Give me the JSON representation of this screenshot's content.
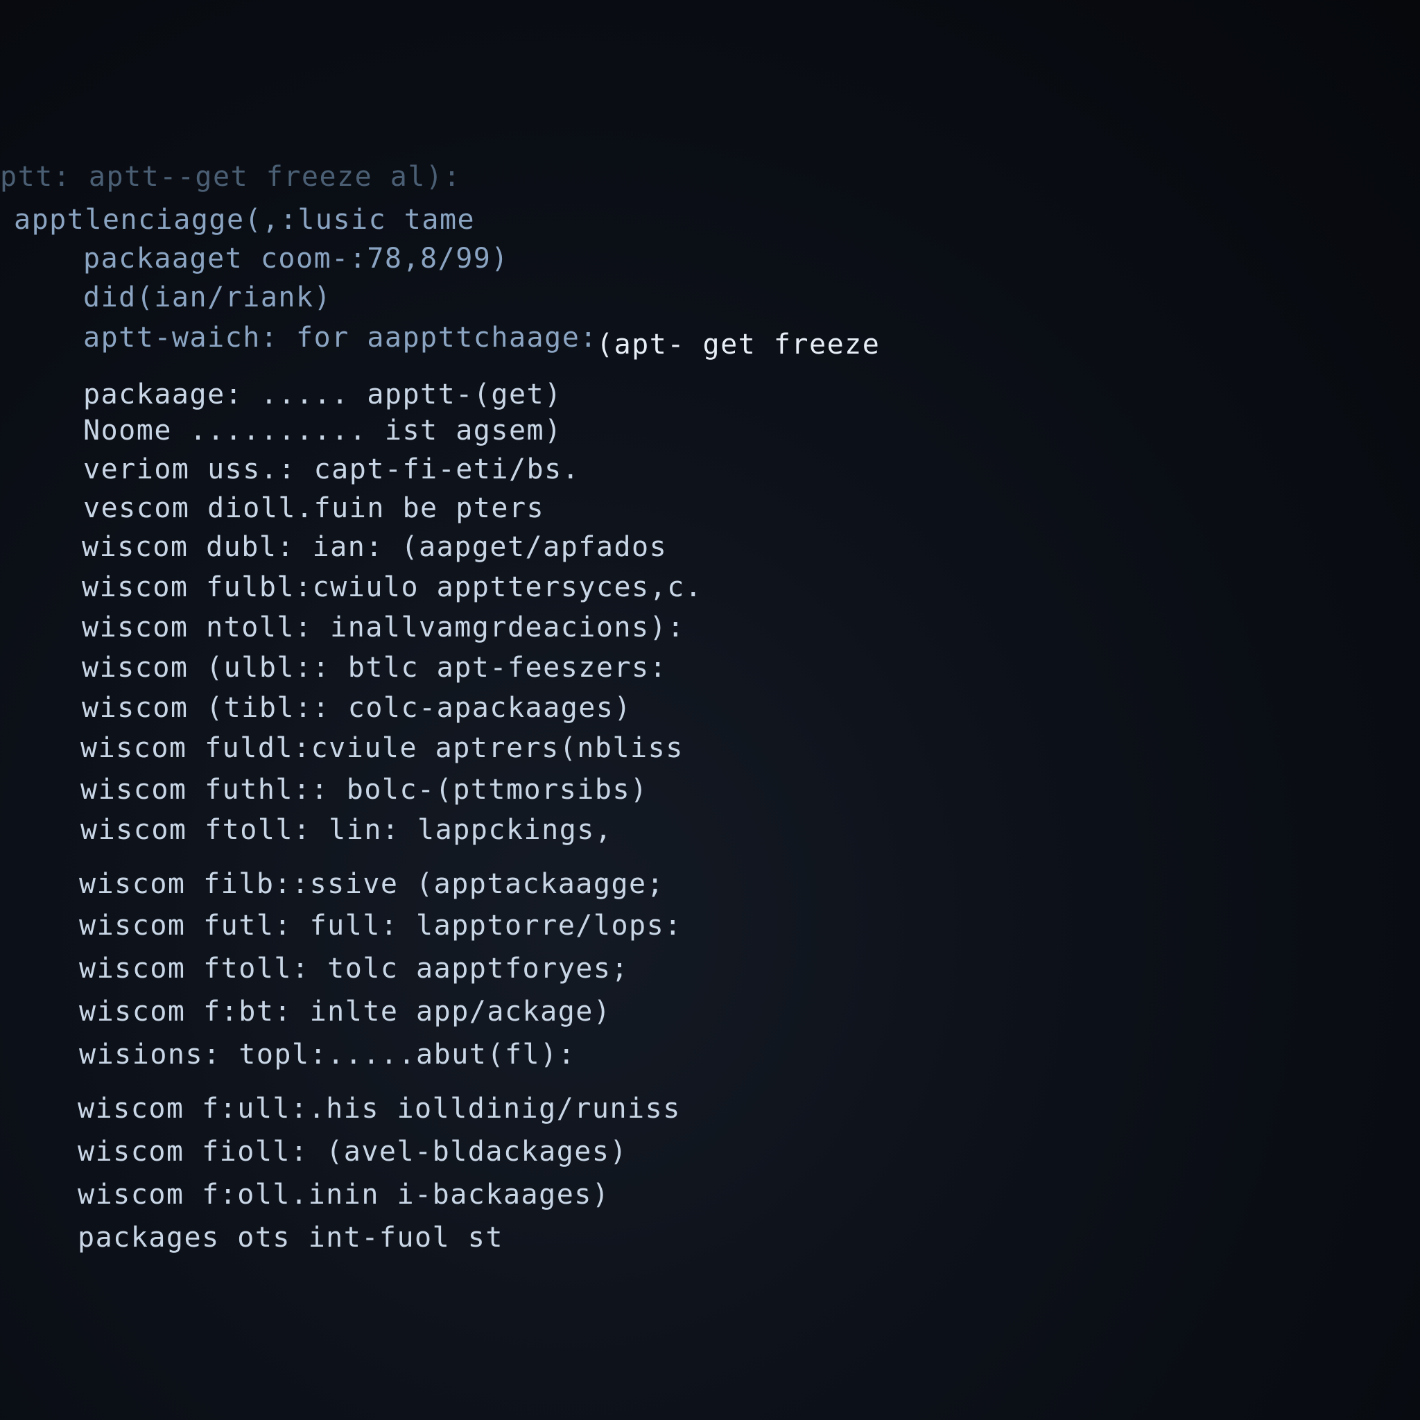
{
  "terminal": {
    "lines": [
      "ptt: aptt--get freeze al):",
      "apptlenciagge(,:lusic tame",
      "packaaget coom-:78,8/99)",
      "did(ian/riank)",
      "aptt-waich: for aappttchaage:",
      "(apt- get freeze",
      "packaage: ..... apptt-(get)",
      "Noome .......... ist agsem)",
      "veriom uss.: capt-fi-eti/bs.",
      "vescom dioll.fuin be pters",
      "wiscom dubl: ian: (aapget/apfados",
      "wiscom fulbl:cwiulo appttersyces,c.",
      "wiscom ntoll: inallvamgrdeacions):",
      "wiscom (ulbl:: btlc apt-feeszers:",
      "wiscom (tibl:: colc-apackaages)",
      "wiscom fuldl:cviule aptrers(nbliss",
      "wiscom futhl:: bolc-(pttmorsibs)",
      "wiscom ftoll: lin: lappckings,",
      "wiscom filb::ssive (apptackaagge;",
      "wiscom futl: full: lapptorre/lops:",
      "wiscom ftoll: tolc aapptforyes;",
      "wiscom f:bt: inlte app/ackage)",
      "wisions: topl:.....abut(fl):",
      "wiscom f:ull:.his iolldinig/runiss",
      "wiscom fioll: (avel-bldackages)",
      "wiscom f:oll.inin i-backaages)",
      "packages ots int-fuol st"
    ]
  }
}
